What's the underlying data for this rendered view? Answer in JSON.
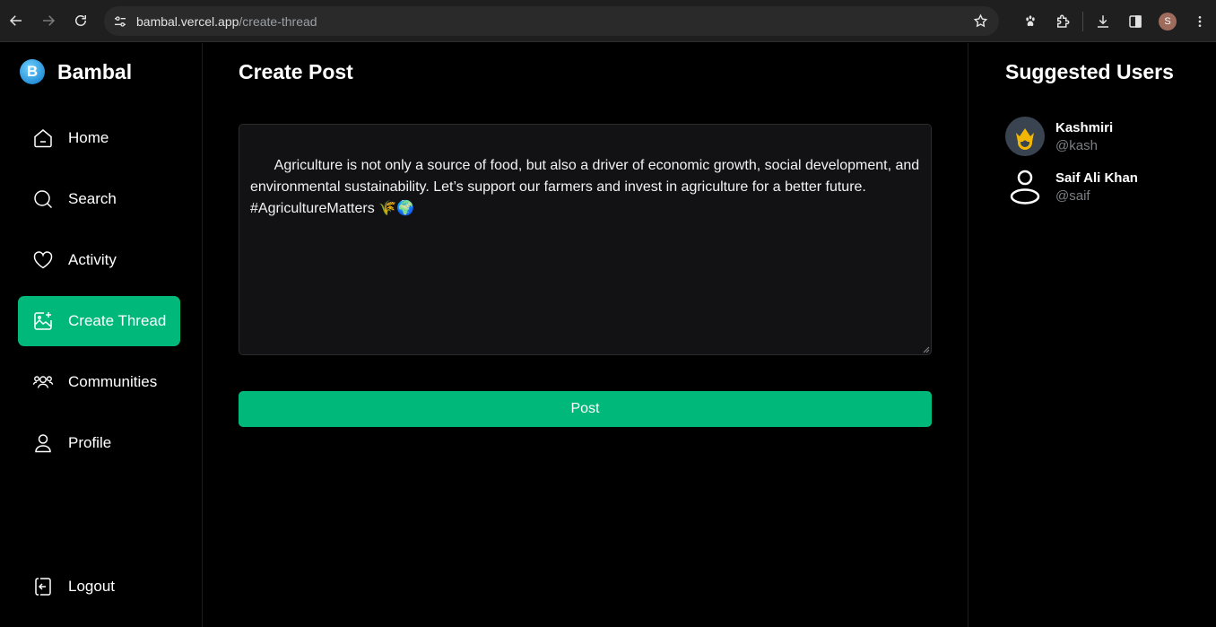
{
  "browser": {
    "url_host": "bambal.vercel.app",
    "url_path": "/create-thread",
    "profile_initial": "S"
  },
  "brand": {
    "logo_letter": "B",
    "name": "Bambal"
  },
  "sidebar": {
    "items": [
      {
        "label": "Home",
        "icon": "home-icon"
      },
      {
        "label": "Search",
        "icon": "search-icon"
      },
      {
        "label": "Activity",
        "icon": "heart-icon"
      },
      {
        "label": "Create Thread",
        "icon": "create-thread-icon",
        "active": true
      },
      {
        "label": "Communities",
        "icon": "communities-icon"
      },
      {
        "label": "Profile",
        "icon": "user-icon"
      }
    ],
    "logout_label": "Logout"
  },
  "main": {
    "title": "Create Post",
    "post_text": "Agriculture is not only a source of food, but also a driver of economic growth, social development, and environmental sustainability. Let’s support our farmers and invest in agriculture for a better future. #AgricultureMatters 🌾🌍",
    "post_button": "Post"
  },
  "suggested": {
    "title": "Suggested Users",
    "users": [
      {
        "name": "Kashmiri",
        "handle": "@kash"
      },
      {
        "name": "Saif Ali Khan",
        "handle": "@saif"
      }
    ]
  },
  "colors": {
    "accent": "#00b87a",
    "background": "#000000",
    "editor_bg": "#121214"
  }
}
